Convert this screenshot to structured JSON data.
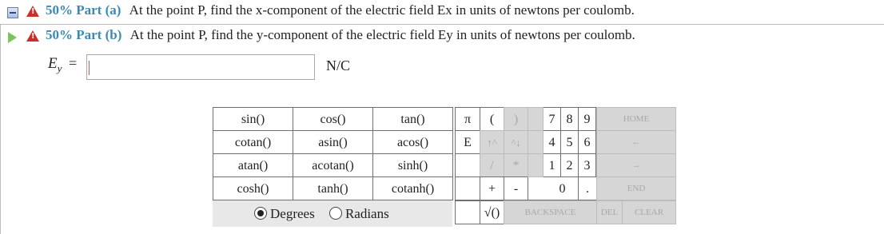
{
  "part_a": {
    "label": "50% Part (a)",
    "question": "At the point P, find the x-component of the electric field Ex in units of newtons per coulomb."
  },
  "part_b": {
    "label": "50% Part (b)",
    "question": "At the point P, find the y-component of the electric field Ey in units of newtons per coulomb."
  },
  "answer": {
    "symbol": "E",
    "subscript": "y",
    "equals": "=",
    "value": "",
    "unit": "N/C"
  },
  "keypad": {
    "functions": [
      [
        "sin()",
        "cos()",
        "tan()"
      ],
      [
        "cotan()",
        "asin()",
        "acos()"
      ],
      [
        "atan()",
        "acotan()",
        "sinh()"
      ],
      [
        "cosh()",
        "tanh()",
        "cotanh()"
      ]
    ],
    "constants": [
      "π",
      "E"
    ],
    "paren_open": "(",
    "paren_close": ")",
    "arrow_up": "↑^",
    "arrow_down": "^↓",
    "divide": "/",
    "multiply": "*",
    "plus": "+",
    "minus": "-",
    "digits": {
      "7": "7",
      "8": "8",
      "9": "9",
      "4": "4",
      "5": "5",
      "6": "6",
      "1": "1",
      "2": "2",
      "3": "3",
      "0": "0"
    },
    "dot": ".",
    "sqrt": "√()",
    "home": "HOME",
    "left_arrow": "←",
    "right_arrow": "→",
    "end": "END",
    "backspace": "BACKSPACE",
    "del": "DEL",
    "clear": "CLEAR"
  },
  "angle_mode": {
    "degrees_label": "Degrees",
    "radians_label": "Radians",
    "selected": "Degrees"
  }
}
